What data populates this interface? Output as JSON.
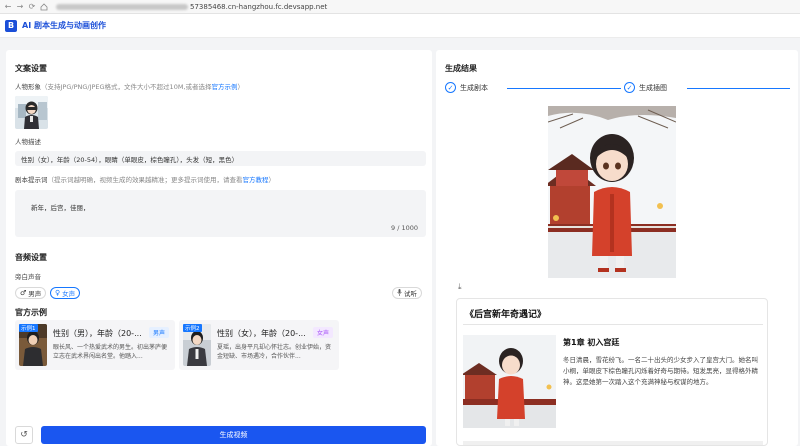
{
  "browser": {
    "back_icon": "arrow-left",
    "forward_icon": "arrow-right",
    "reload_icon": "reload",
    "url": "57385468.cn-hangzhou.fc.devsapp.net"
  },
  "app": {
    "logo_text": "B",
    "title": "AI 剧本生成与动画创作"
  },
  "left": {
    "copy_settings_title": "文案设置",
    "avatar_label": "人物形象",
    "avatar_hint": "（支持JPG/PNG/JPEG格式，文件大小不超过10M,或者选择",
    "avatar_link": "官方示例",
    "avatar_hint_end": "）",
    "desc_label": "人物描述",
    "desc_value": "性别（女），年龄（20-54），眼睛（单眼皮，棕色瞳孔），头发（短，黑色）",
    "prompt_label": "剧本提示词",
    "prompt_hint": "（提示词越明确，视频生成的效果越精准；更多提示词使用，请查看",
    "prompt_link": "官方教程",
    "prompt_hint_end": "）",
    "prompt_value": "新年，后宫，佳丽，",
    "prompt_count": "9 / 1000",
    "audio_title": "音频设置",
    "narration_label": "旁白声音",
    "male_voice": "男声",
    "female_voice": "女声",
    "listen": "试听",
    "examples_title": "官方示例",
    "examples": [
      {
        "tag": "示例1",
        "title": "性别（男），年龄（20-...",
        "badge": "男声",
        "desc": "眼长风、一个热爱武术的男生。初出茅庐便立志在武术界闯出名堂。他踏入..."
      },
      {
        "tag": "示例2",
        "title": "性别（女），年龄（20-...",
        "badge": "女声",
        "desc": "夏瑶，出身平凡却心怀壮志。创业伊始，资金短缺、市场遇冷，合作伙伴..."
      }
    ],
    "generate_button": "生成视频"
  },
  "right": {
    "result_title": "生成结果",
    "step1": "生成剧本",
    "step2": "生成插图",
    "story_title": "《后宫新年奇遇记》",
    "chapter_title": "第1章 初入宫廷",
    "chapter_text": "冬日清晨，雪花纷飞。一名二十出头的少女步入了皇宫大门。她名叫小桐，单眼皮下棕色瞳孔闪烁着好奇与期待。短发黑亮，显得格外精神。这是她第一次踏入这个充满神秘与权谋的地方。"
  },
  "colors": {
    "accent": "#1677ff",
    "primary_button": "#1a56f0",
    "female_badge": "#a855f7"
  }
}
